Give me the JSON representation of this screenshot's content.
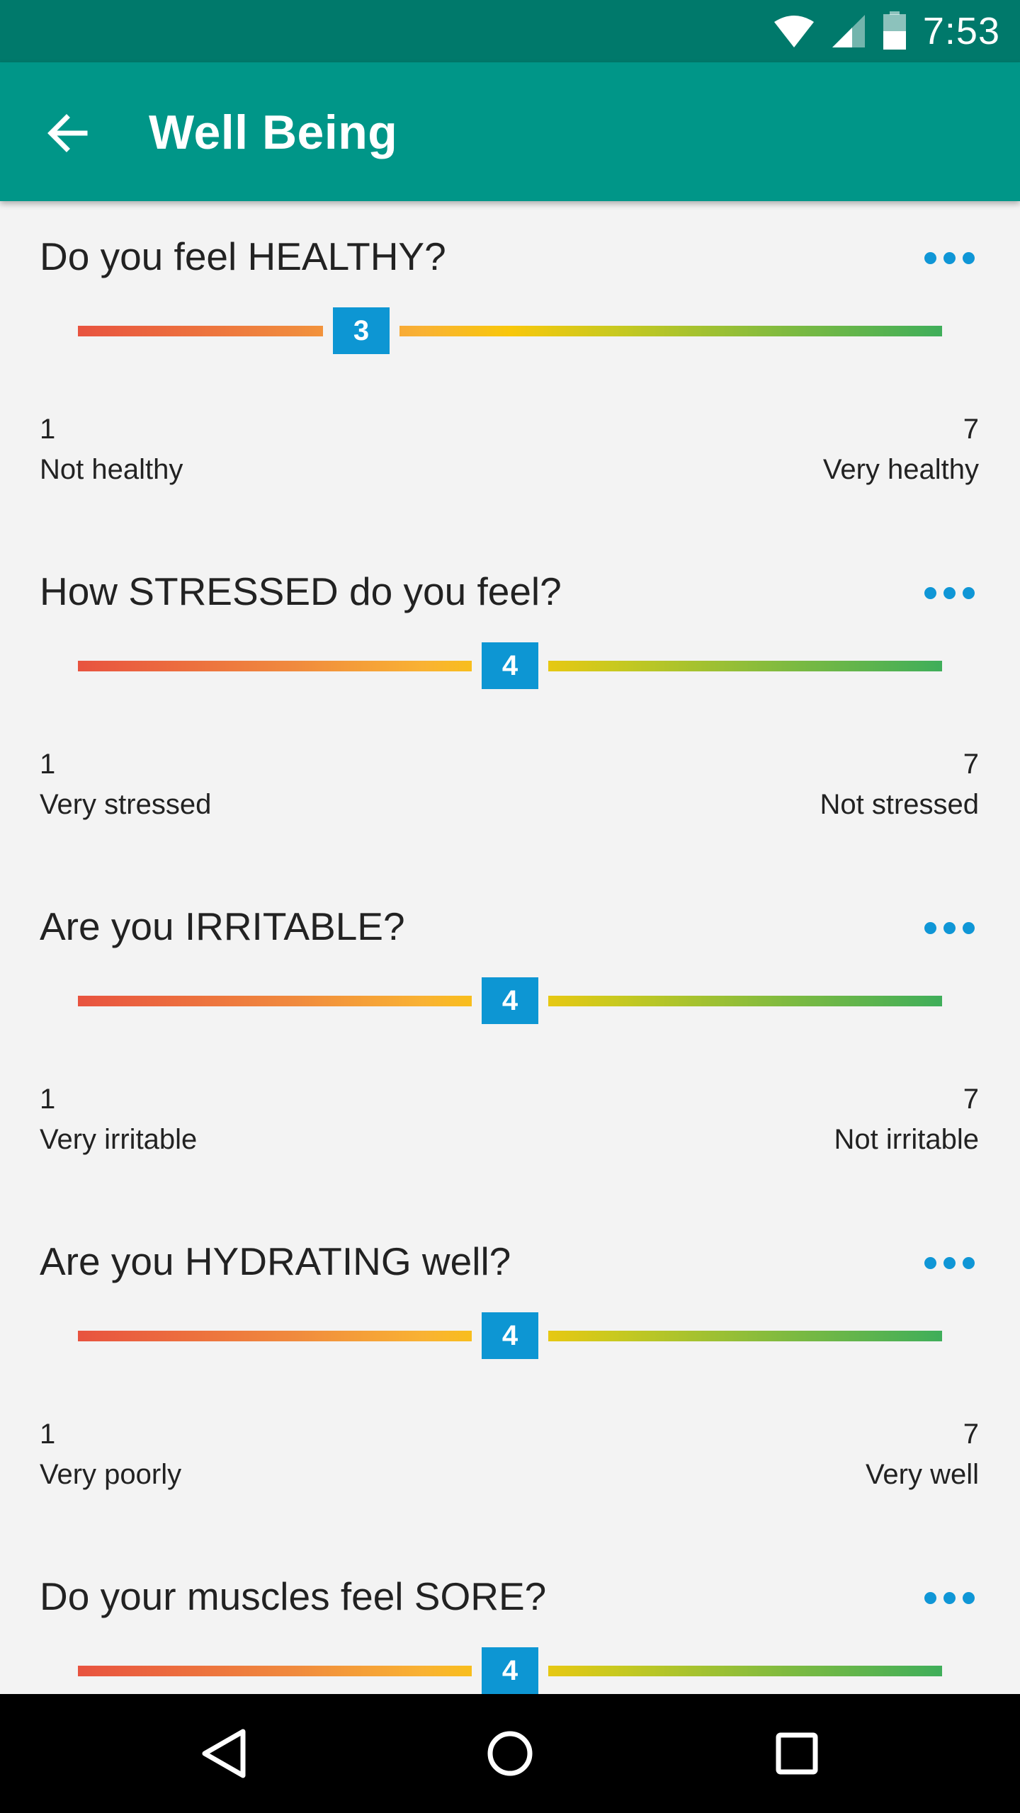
{
  "status_bar": {
    "time": "7:53",
    "icons": [
      "wifi-icon",
      "signal-icon",
      "battery-icon"
    ]
  },
  "app_bar": {
    "title": "Well Being",
    "back_icon": "arrow-back-icon"
  },
  "accent_color": "#009688",
  "questions": [
    {
      "title": "Do you feel HEALTHY?",
      "value": "3",
      "min": "1",
      "max": "7",
      "min_label": "Not healthy",
      "max_label": "Very healthy"
    },
    {
      "title": "How STRESSED do you feel?",
      "value": "4",
      "min": "1",
      "max": "7",
      "min_label": "Very stressed",
      "max_label": "Not stressed"
    },
    {
      "title": "Are you IRRITABLE?",
      "value": "4",
      "min": "1",
      "max": "7",
      "min_label": "Very irritable",
      "max_label": "Not irritable"
    },
    {
      "title": "Are you HYDRATING well?",
      "value": "4",
      "min": "1",
      "max": "7",
      "min_label": "Very poorly",
      "max_label": "Very well"
    },
    {
      "title": "Do your muscles feel SORE?",
      "value": "4",
      "min": "1",
      "max": "7",
      "min_label": "",
      "max_label": ""
    }
  ],
  "nav_bar": {
    "icons": [
      "back-triangle-icon",
      "home-circle-icon",
      "recents-square-icon"
    ]
  }
}
